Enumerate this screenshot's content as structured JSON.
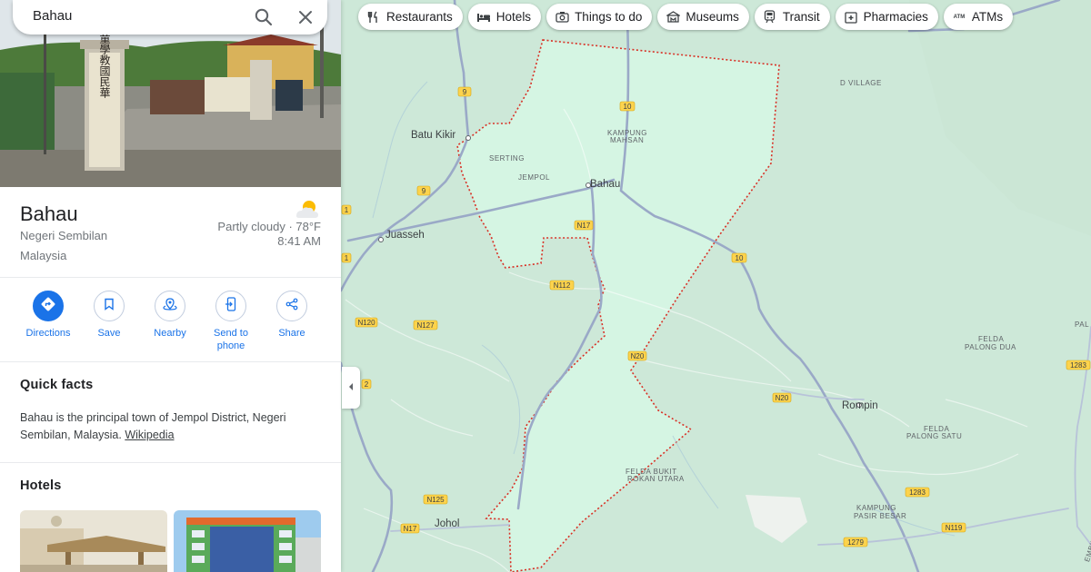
{
  "search": {
    "query": "Bahau"
  },
  "place": {
    "name": "Bahau",
    "region": "Negeri Sembilan",
    "country": "Malaysia",
    "hero_sign_text": "小童學教國民華"
  },
  "weather": {
    "description": "Partly cloudy · 78°F",
    "time": "8:41 AM",
    "icon": "partly-cloudy-icon"
  },
  "actions": [
    {
      "label": "Directions",
      "icon": "directions-icon"
    },
    {
      "label": "Save",
      "icon": "bookmark-icon"
    },
    {
      "label": "Nearby",
      "icon": "nearby-icon"
    },
    {
      "label": "Send to phone",
      "icon": "send-to-phone-icon"
    },
    {
      "label": "Share",
      "icon": "share-icon"
    }
  ],
  "quick_facts": {
    "title": "Quick facts",
    "text": "Bahau is the principal town of Jempol District, Negeri Sembilan, Malaysia. ",
    "link": "Wikipedia"
  },
  "hotels": {
    "title": "Hotels"
  },
  "chips": [
    {
      "label": "Restaurants",
      "icon": "fork-knife-icon"
    },
    {
      "label": "Hotels",
      "icon": "bed-icon"
    },
    {
      "label": "Things to do",
      "icon": "camera-icon"
    },
    {
      "label": "Museums",
      "icon": "museum-icon"
    },
    {
      "label": "Transit",
      "icon": "train-icon"
    },
    {
      "label": "Pharmacies",
      "icon": "pharmacy-icon"
    },
    {
      "label": "ATMs",
      "icon": "atm-icon"
    }
  ],
  "map": {
    "colors": {
      "land": "#cde8d8",
      "highlight": "#d5f5e3",
      "boundary": "#d93025",
      "road": "#9aa9c7",
      "shield": "#fcd34d"
    },
    "towns": [
      "Bahau",
      "Batu Kikir",
      "Juasseh",
      "Rompin",
      "Johol"
    ],
    "small_places": [
      "D VILLAGE",
      "KAMPUNG",
      "MAHSAN",
      "SERTING",
      "JEMPOL",
      "FELDA",
      "PALONG DUA",
      "FELDA",
      "PALONG SATU",
      "FELDA BUKIT",
      "ROKAN UTARA",
      "KAMPUNG",
      "PASIR BESAR",
      "PAL",
      "EMBILAN"
    ],
    "road_labels": [
      "9",
      "9",
      "10",
      "10",
      "N17",
      "N112",
      "N120",
      "N127",
      "N20",
      "N20",
      "1283",
      "1283",
      "N125",
      "N17",
      "1279",
      "N119",
      "1",
      "1",
      "2"
    ]
  }
}
